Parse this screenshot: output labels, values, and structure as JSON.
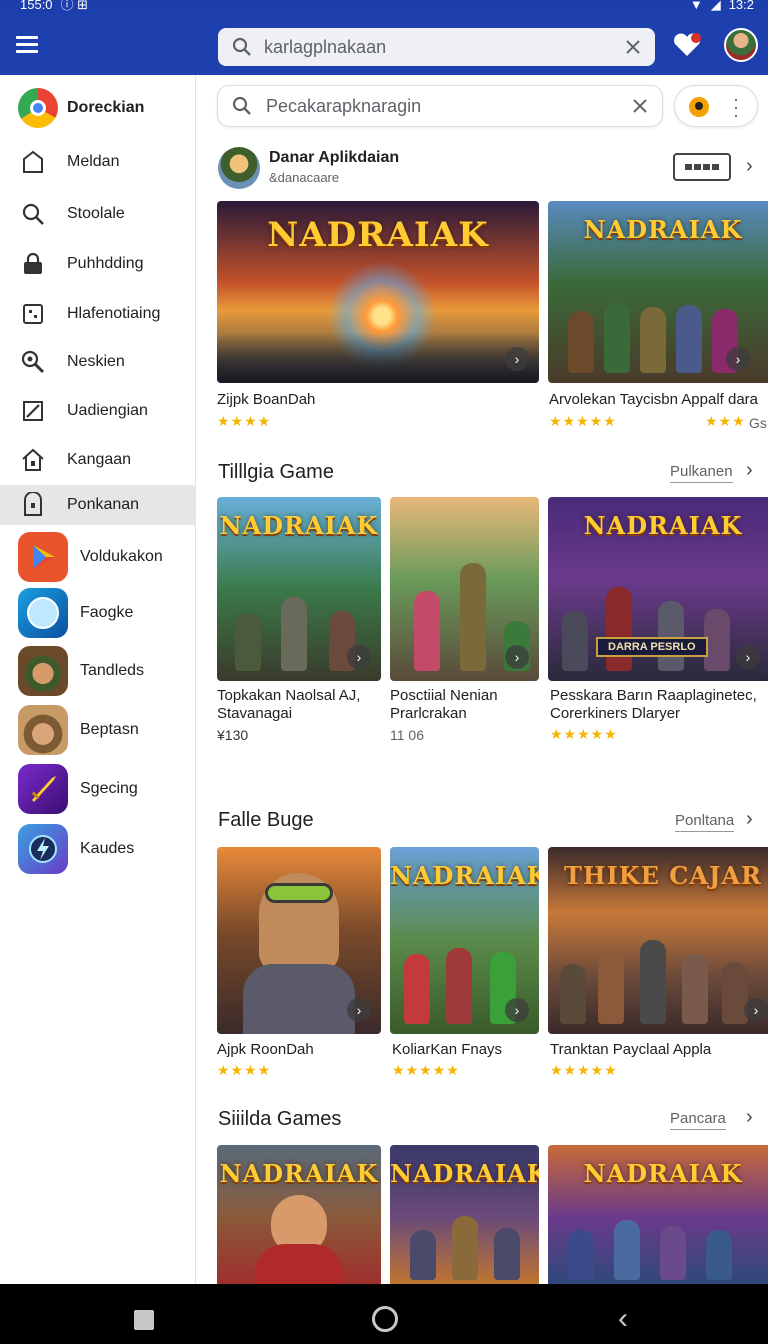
{
  "status_bar": {
    "time": "155:0",
    "left_icons": "ⓘ ⊞",
    "right_text": "13:2"
  },
  "top_search": {
    "placeholder": "karlagplnakaan"
  },
  "sidebar": {
    "profile_label": "Doreckian",
    "items": [
      {
        "label": "Meldan",
        "icon": "folder-icon"
      },
      {
        "label": "Stoolale",
        "icon": "search-icon"
      },
      {
        "label": "Puhhdding",
        "icon": "lock-icon"
      },
      {
        "label": "Hlafenotiaing",
        "icon": "calendar-icon"
      },
      {
        "label": "Neskien",
        "icon": "zoom-icon"
      },
      {
        "label": "Uadiengian",
        "icon": "edit-icon"
      },
      {
        "label": "Kangaan",
        "icon": "home-icon"
      },
      {
        "label": "Ponkanan",
        "icon": "badge-icon"
      }
    ],
    "apps": [
      {
        "label": "Voldukakon",
        "icon": "play-store-icon"
      },
      {
        "label": "Faogke",
        "icon": "compass-icon"
      },
      {
        "label": "Tandleds",
        "icon": "explorer-avatar-icon"
      },
      {
        "label": "Beptasn",
        "icon": "explorer-avatar-icon"
      },
      {
        "label": "Sgecing",
        "icon": "sword-icon"
      },
      {
        "label": "Kaudes",
        "icon": "lightning-icon"
      }
    ]
  },
  "main": {
    "search_placeholder": "Pecakarapknaragin",
    "developer": {
      "name": "Danar Aplikdaian",
      "subtitle": "&danacaare"
    },
    "featured": [
      {
        "title": "Zijpk BoanDah",
        "logo": "NADRAIAK",
        "stars": "★★★★"
      },
      {
        "title": "Arvolekan Taycisbn Appalf dara",
        "logo": "NADRAIAK",
        "stars": "★★★★★",
        "stars2": "★★★",
        "rating_suffix": "Gs"
      }
    ],
    "sections": [
      {
        "title": "Tilllgia Game",
        "link": "Pulkanen",
        "cards": [
          {
            "title": "Topkakan Naolsal AJ,",
            "title2": "Stavanagai",
            "logo": "NADRAIAK",
            "rating": "¥130"
          },
          {
            "title": "Posctiial Nenian",
            "title2": "Prarlcrakan",
            "logo": "",
            "rating": "11 06"
          },
          {
            "title": "Pesskara Barın Raaplaginetec,",
            "title2": "Corerkiners Dlaryer",
            "logo": "NADRAIAK",
            "stars": "★★★★★",
            "banner": "DARRA PESRLO"
          }
        ]
      },
      {
        "title": "Falle Buge",
        "link": "Ponltana",
        "cards": [
          {
            "title": "Ajpk RoonDah",
            "logo": "",
            "stars": "★★★★"
          },
          {
            "title": "KoliarKan Fnays",
            "logo": "NADRAIAK",
            "stars": "★★★★★"
          },
          {
            "title": "Tranktan Payclaal Appla",
            "logo": "THIKE CAJAR",
            "stars": "★★★★★"
          }
        ]
      },
      {
        "title": "Siiilda Games",
        "link": "Pancara",
        "cards": [
          {
            "logo": "NADRAIAK"
          },
          {
            "logo": "NADRAIAK"
          },
          {
            "logo": "NADRAIAK"
          }
        ]
      }
    ]
  },
  "colors": {
    "appbar": "#1e40af",
    "star": "#f4b400",
    "logo": "#ffcc33"
  }
}
